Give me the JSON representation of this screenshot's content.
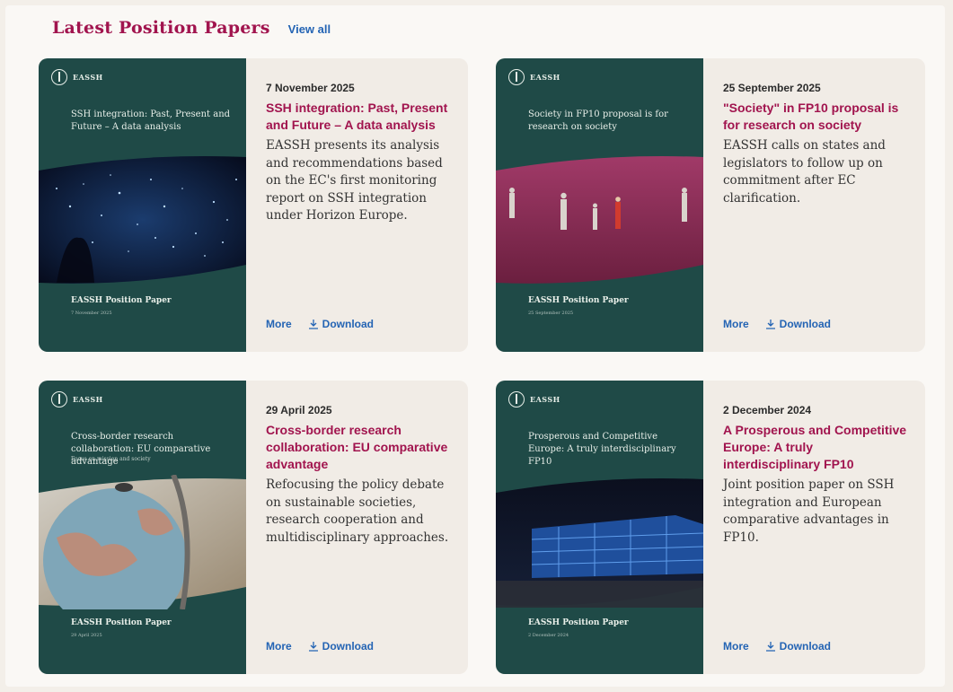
{
  "header": {
    "title": "Latest Position Papers",
    "view_all": "View all"
  },
  "colors": {
    "accent": "#a1144e",
    "link": "#2464b4",
    "cover_green": "#1f4a47",
    "card_bg": "#f1ece6"
  },
  "cards": [
    {
      "date": "7 November 2025",
      "title": "SSH integration: Past, Present and Future – A data analysis",
      "description": "EASSH presents its analysis and recommendations based on the EC's first monitoring report on SSH integration under Horizon Europe.",
      "more": "More",
      "download": "Download",
      "cover": {
        "logo": "EASSH",
        "title": "SSH integration: Past, Present and Future – A data analysis",
        "subtitle": "",
        "footer": "EASSH Position Paper",
        "footer_date": "7 November 2025"
      }
    },
    {
      "date": "25 September 2025",
      "title": "\"Society\" in FP10 proposal is for research on society",
      "description": "EASSH calls on states and legislators to follow up on commitment after EC clarification.",
      "more": "More",
      "download": "Download",
      "cover": {
        "logo": "EASSH",
        "title": "Society in FP10 proposal is for research on society",
        "subtitle": "",
        "footer": "EASSH Position Paper",
        "footer_date": "25 September 2025"
      }
    },
    {
      "date": "29 April 2025",
      "title": "Cross-border research collaboration: EU comparative advantage",
      "description": "Refocusing the policy debate on sustainable societies, research cooperation and multidisciplinary approaches.",
      "more": "More",
      "download": "Download",
      "cover": {
        "logo": "EASSH",
        "title": "Cross-border research collaboration: EU comparative advantage",
        "subtitle": "Focus on mission and society",
        "footer": "EASSH Position Paper",
        "footer_date": "29 April 2025"
      }
    },
    {
      "date": "2 December 2024",
      "title": "A Prosperous and Competitive Europe: A truly interdisciplinary FP10",
      "description": "Joint position paper on SSH integration and European comparative advantages in FP10.",
      "more": "More",
      "download": "Download",
      "cover": {
        "logo": "EASSH",
        "title": "Prosperous and Competitive Europe: A truly interdisciplinary FP10",
        "subtitle": "",
        "footer": "EASSH Position Paper",
        "footer_date": "2 December 2024"
      }
    }
  ]
}
